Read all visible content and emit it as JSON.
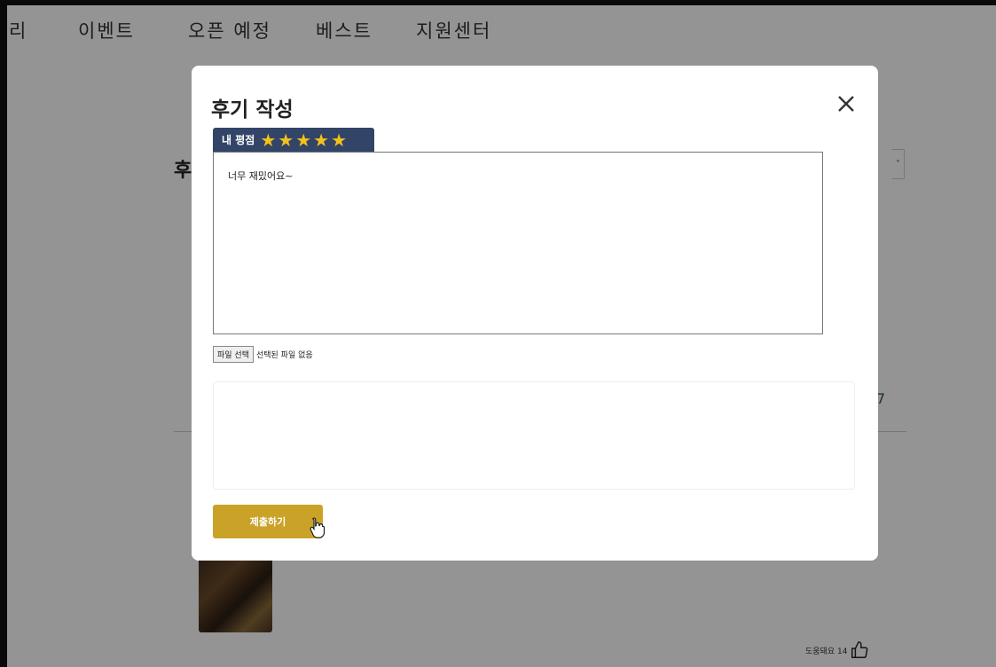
{
  "nav": {
    "items": [
      "리",
      "이벤트",
      "오픈 예정",
      "베스트",
      "지원센터"
    ]
  },
  "background": {
    "heading_fragment": "후",
    "helpful_label": "도움돼요 14",
    "select_chevron": "˅",
    "partial_mark": "7"
  },
  "modal": {
    "title": "후기 작성",
    "close_icon": "close-icon",
    "rating_label": "내 평점",
    "rating": 5,
    "rating_max": 5,
    "stars": [
      "★",
      "★",
      "★",
      "★",
      "★"
    ],
    "review_text": "너무 재밌어요~",
    "file_button": "파일 선택",
    "file_status": "선택된 파일 없음",
    "submit_label": "제출하기"
  },
  "colors": {
    "rating_tab": "#324467",
    "star": "#f3c21a",
    "submit": "#c9a227"
  }
}
